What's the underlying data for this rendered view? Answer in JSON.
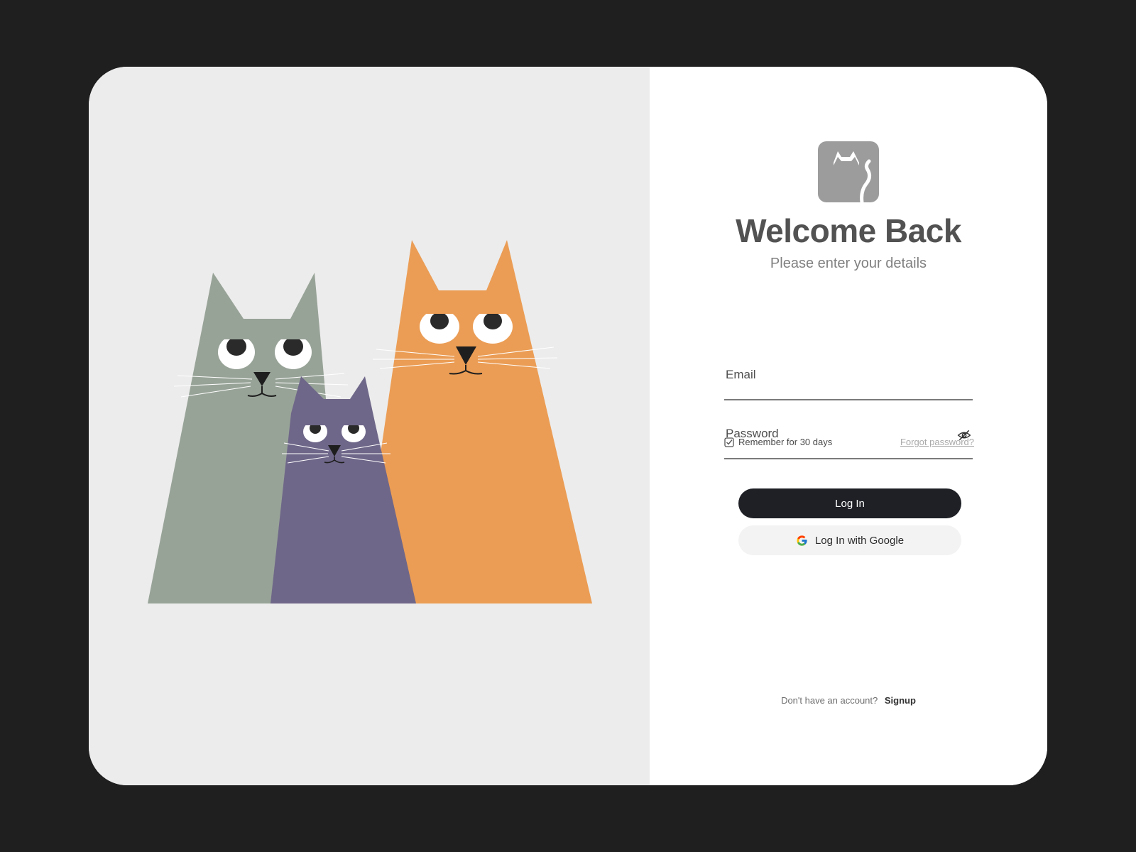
{
  "illustration": {
    "name": "three-cats",
    "colors": {
      "background": "#ececec",
      "gray_cat": "#98a398",
      "purple_cat": "#6f6789",
      "orange_cat": "#eb9d55"
    }
  },
  "logo": {
    "icon": "cat-logo-icon",
    "color": "#9c9c9c"
  },
  "header": {
    "title": "Welcome Back",
    "subtitle": "Please enter your details"
  },
  "form": {
    "email_label": "Email",
    "password_label": "Password",
    "password_icon": "eye-off-icon",
    "remember_label": "Remember for 30 days",
    "remember_checked": true,
    "forgot_label": "Forgot password?"
  },
  "actions": {
    "login_label": "Log In",
    "google_label": "Log In with Google"
  },
  "footer": {
    "prompt": "Don't have an account?",
    "signup_label": "Signup"
  }
}
